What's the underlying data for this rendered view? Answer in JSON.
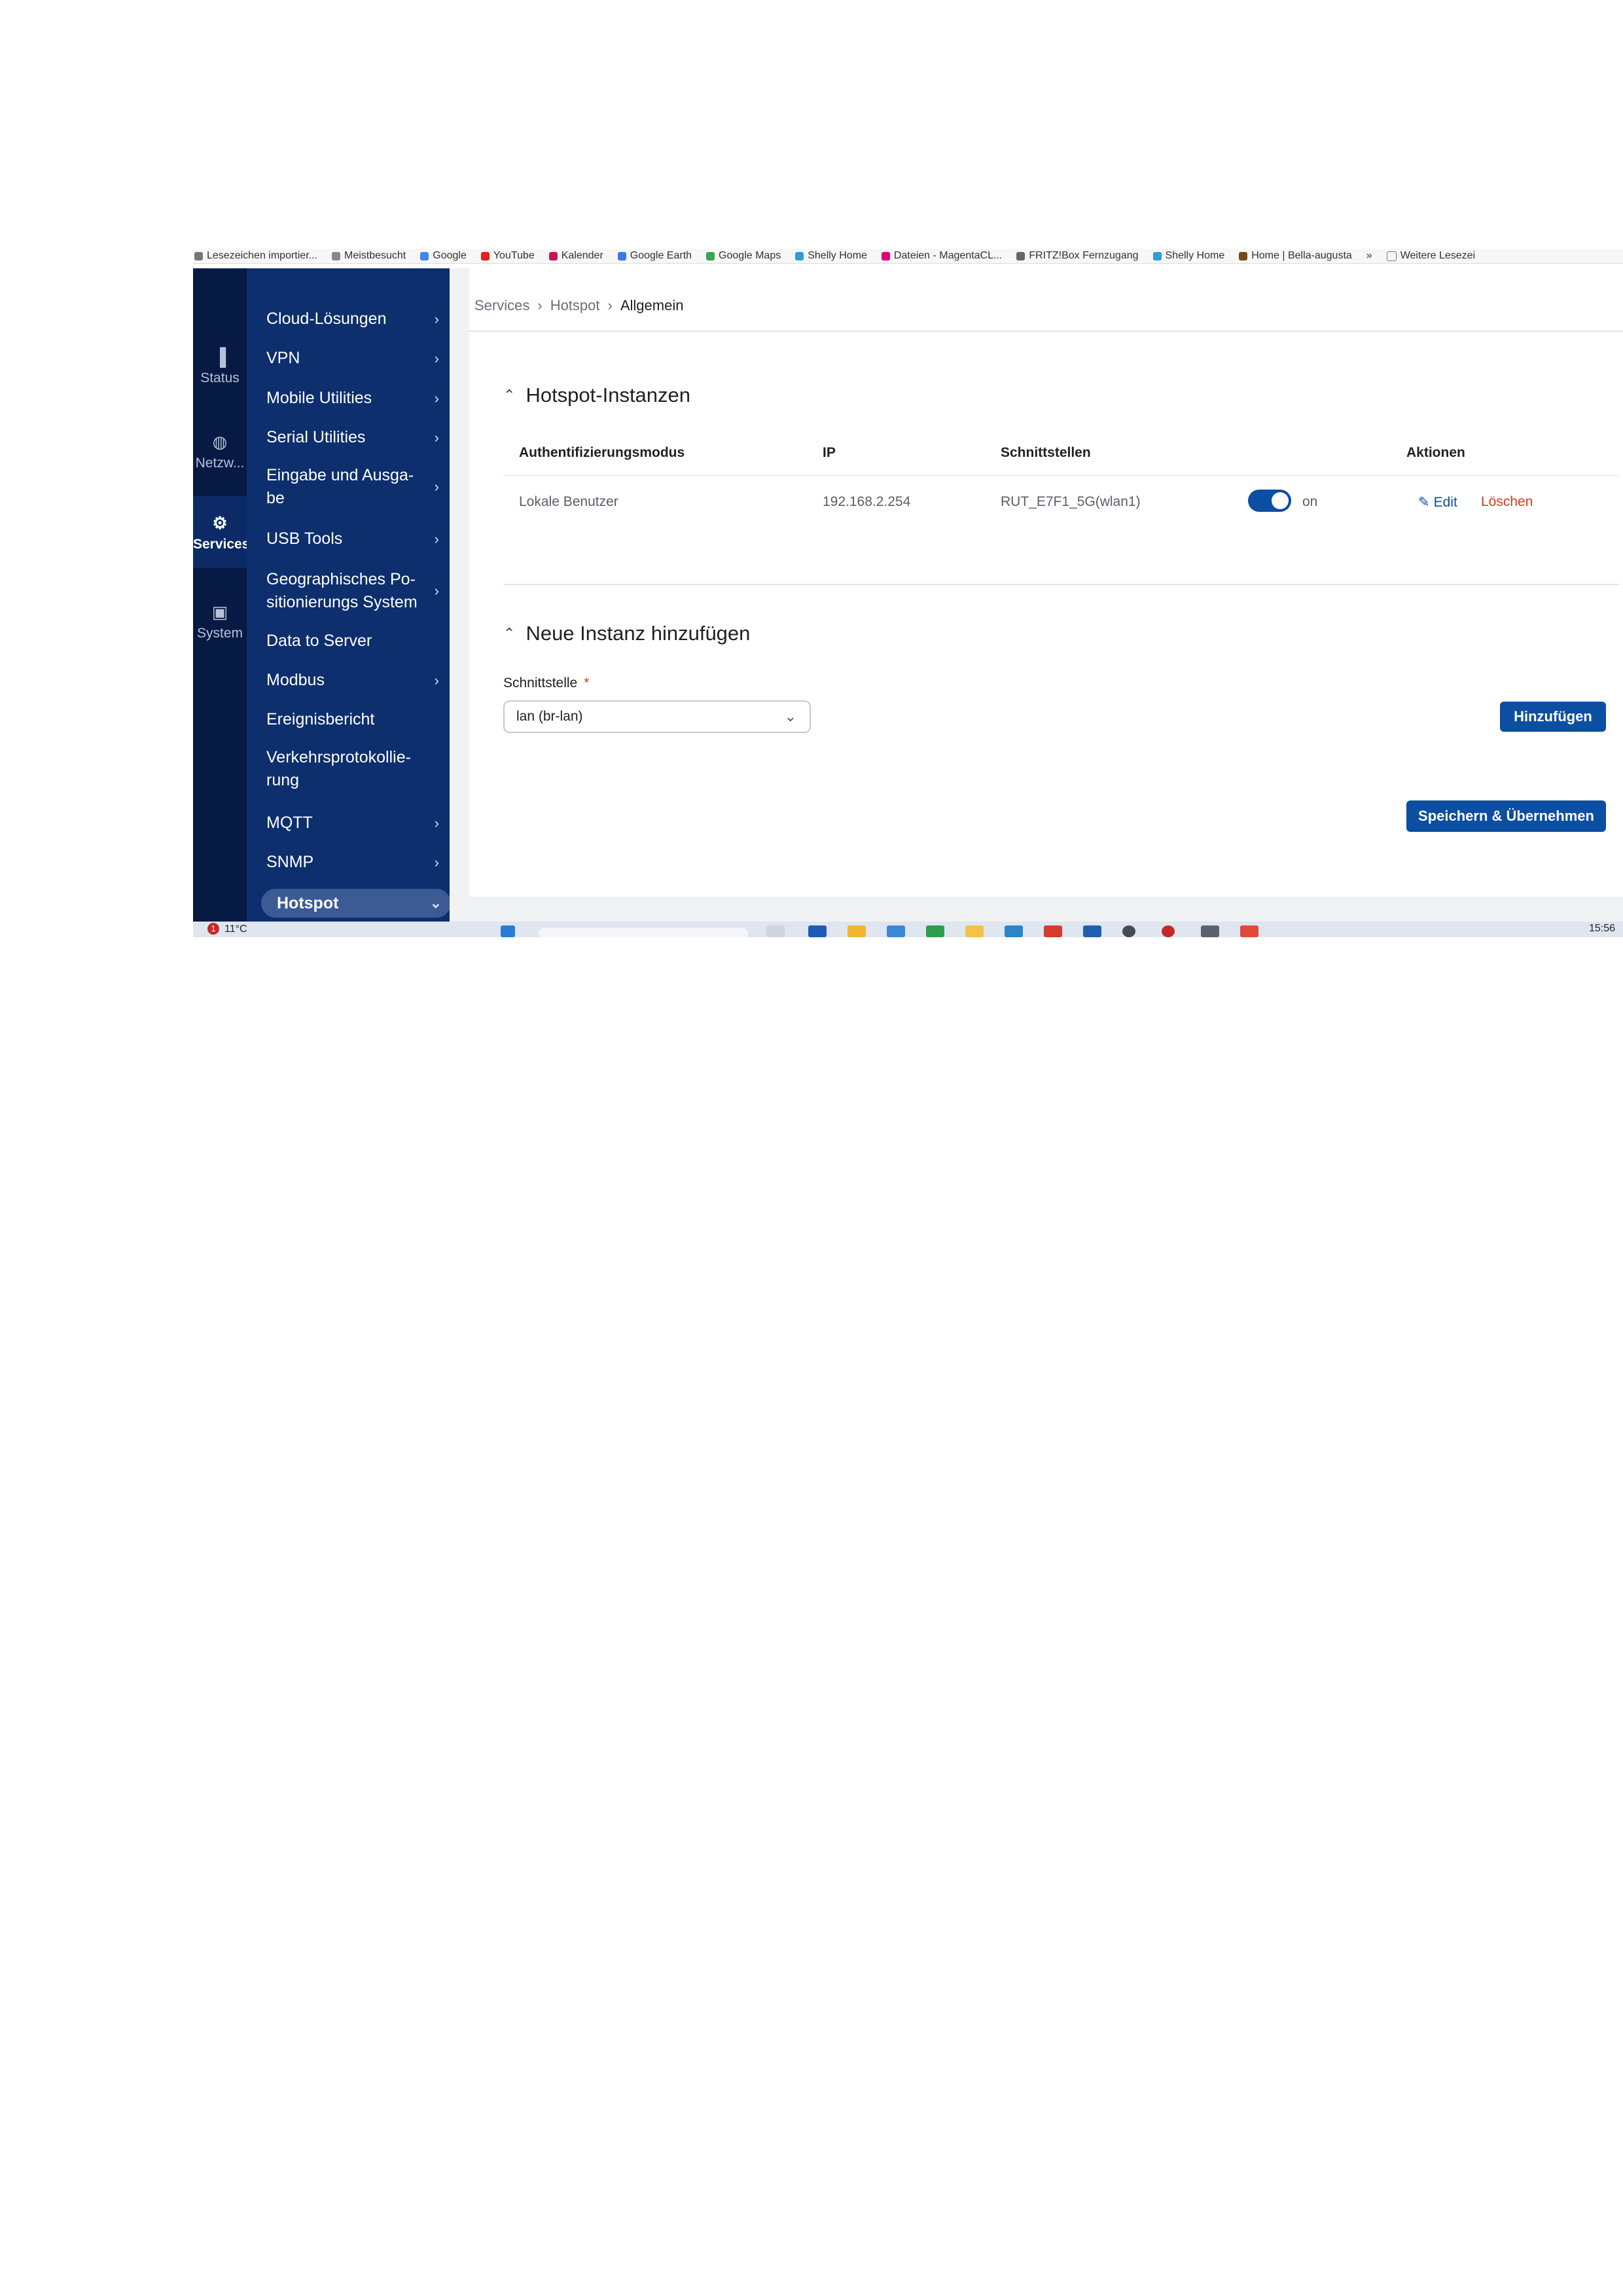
{
  "bookmarks": [
    {
      "label": "Lesezeichen importier...",
      "color": "#777777"
    },
    {
      "label": "Meistbesucht",
      "color": "#888888"
    },
    {
      "label": "Google",
      "color": "#4285f4"
    },
    {
      "label": "YouTube",
      "color": "#e62117"
    },
    {
      "label": "Kalender",
      "color": "#c2185b"
    },
    {
      "label": "Google Earth",
      "color": "#3b78e7"
    },
    {
      "label": "Google Maps",
      "color": "#34a853"
    },
    {
      "label": "Shelly Home",
      "color": "#2d9cdb"
    },
    {
      "label": "Dateien - MagentaCL...",
      "color": "#e20074"
    },
    {
      "label": "FRITZ!Box Fernzugang",
      "color": "#666666"
    },
    {
      "label": "Shelly Home",
      "color": "#2d9cdb"
    },
    {
      "label": "Home | Bella-augusta",
      "color": "#7a4a14"
    }
  ],
  "bookmarks_overflow": "»",
  "bookmarks_more": "Weitere Lesezei",
  "rail": [
    {
      "label": "Status",
      "icon": "▐"
    },
    {
      "label": "Netzw...",
      "icon": "◍"
    },
    {
      "label": "Services",
      "icon": "⚙"
    },
    {
      "label": "System",
      "icon": "▣"
    }
  ],
  "menu": [
    {
      "label": "Cloud-Lösungen",
      "chevron": "›"
    },
    {
      "label": "VPN",
      "chevron": "›"
    },
    {
      "label": "Mobile Utilities",
      "chevron": "›"
    },
    {
      "label": "Serial Utilities",
      "chevron": "›"
    },
    {
      "label": "Eingabe und Ausga-be",
      "chevron": "›"
    },
    {
      "label": "USB Tools",
      "chevron": "›"
    },
    {
      "label": "Geographisches Po-sitionierungs System",
      "chevron": "›"
    },
    {
      "label": "Data to Server",
      "chevron": ""
    },
    {
      "label": "Modbus",
      "chevron": "›"
    },
    {
      "label": "Ereignisbericht",
      "chevron": ""
    },
    {
      "label": "Verkehrsprotokollie-rung",
      "chevron": ""
    },
    {
      "label": "MQTT",
      "chevron": "›"
    },
    {
      "label": "SNMP",
      "chevron": "›"
    },
    {
      "label": "Hotspot",
      "chevron": "⌄"
    }
  ],
  "breadcrumb": {
    "items": [
      "Services",
      "Hotspot"
    ],
    "current": "Allgemein",
    "separator": "›"
  },
  "instances": {
    "title": "Hotspot-Instanzen",
    "columns": [
      "Authentifizierungsmodus",
      "IP",
      "Schnittstellen",
      "Aktionen"
    ],
    "row": {
      "auth": "Lokale Benutzer",
      "ip": "192.168.2.254",
      "interface": "RUT_E7F1_5G(wlan1)",
      "toggle_label": "on",
      "edit": "Edit",
      "delete": "Löschen"
    }
  },
  "add": {
    "title": "Neue Instanz hinzufügen",
    "field_label": "Schnittstelle",
    "required_mark": "*",
    "select_value": "lan (br-lan)",
    "add_button": "Hinzufügen"
  },
  "save_button": "Speichern & Übernehmen",
  "taskbar": {
    "weather": "11°C",
    "badge": "1",
    "time": "15:56"
  },
  "colors": {
    "rail": "#071a44",
    "menu": "#0d2f6e",
    "accent": "#0b4ea2",
    "danger": "#d13b1b"
  }
}
